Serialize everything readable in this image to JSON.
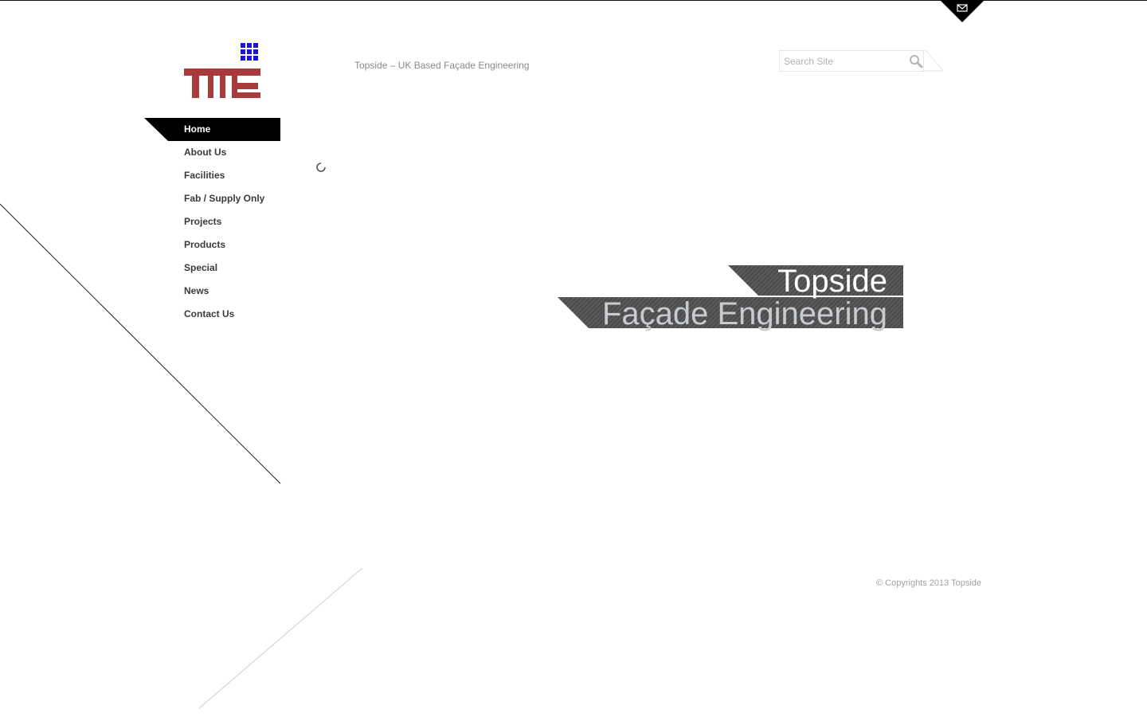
{
  "header": {
    "tagline": "Topside – UK Based Façade Engineering",
    "mail_icon": "envelope-icon",
    "logo": {
      "letters": "TME",
      "icon": "grid-squares-icon"
    }
  },
  "search": {
    "placeholder": "Search Site",
    "value": "",
    "icon": "magnifier-icon"
  },
  "nav": {
    "items": [
      {
        "label": "Home",
        "active": true
      },
      {
        "label": "About Us"
      },
      {
        "label": "Facilities"
      },
      {
        "label": "Fab / Supply Only"
      },
      {
        "label": "Projects"
      },
      {
        "label": "Products"
      },
      {
        "label": "Special"
      },
      {
        "label": "News"
      },
      {
        "label": "Contact Us"
      }
    ]
  },
  "hero": {
    "line1": "Topside",
    "line2": "Façade Engineering"
  },
  "loader": {
    "icon": "loading-spinner-icon"
  },
  "footer": {
    "copyright": "© Copyrights 2013 Topside"
  },
  "colors": {
    "logo_red": "#a93a3c",
    "logo_blue": "#1a14d6",
    "nav_active_bg": "#000000",
    "band_stripe": "#4a4a4a"
  }
}
